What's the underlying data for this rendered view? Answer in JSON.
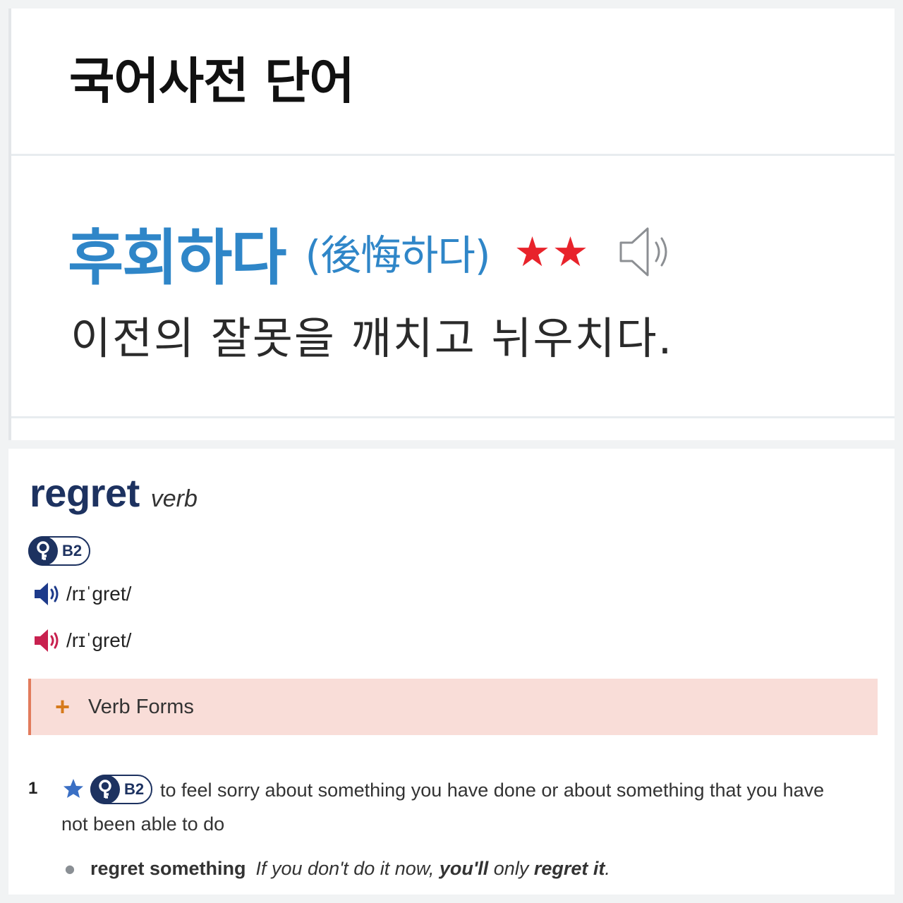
{
  "korean_dictionary": {
    "title": "국어사전 단어",
    "entry": {
      "word": "후회하다",
      "hanja": "(後悔하다)",
      "stars": "★★",
      "speaker_icon": "speaker-outline-icon",
      "definition": "이전의 잘못을 깨치고 뉘우치다."
    },
    "colors": {
      "word": "#2f86c8",
      "stars": "#e8232b"
    }
  },
  "english_dictionary": {
    "headword": "regret",
    "part_of_speech": "verb",
    "level": "B2",
    "pronunciations": [
      {
        "variant_icon": "speaker-blue-icon",
        "ipa": "/rɪˈɡret/",
        "color": "#1d3a8a"
      },
      {
        "variant_icon": "speaker-pink-icon",
        "ipa": "/rɪˈɡret/",
        "color": "#c8214f"
      }
    ],
    "verb_forms": {
      "expand_symbol": "+",
      "label": "Verb Forms"
    },
    "senses": [
      {
        "number": "1",
        "star_icon": "star-icon",
        "level": "B2",
        "definition_line1": "to feel sorry about something you have done or about something that you have",
        "definition_line2": "not been able to do",
        "examples": [
          {
            "pattern": "regret something",
            "sentence_part1": "If you don't do it now, ",
            "sentence_bold1": "you'll",
            "sentence_part2": " only ",
            "sentence_bold2": "regret it",
            "sentence_part3": "."
          }
        ]
      }
    ],
    "colors": {
      "headword": "#1d3260",
      "verb_forms_bg": "#f9ddd8",
      "verb_forms_accent": "#e27b5c",
      "plus": "#d67a1c",
      "star": "#3a6fc4"
    }
  }
}
